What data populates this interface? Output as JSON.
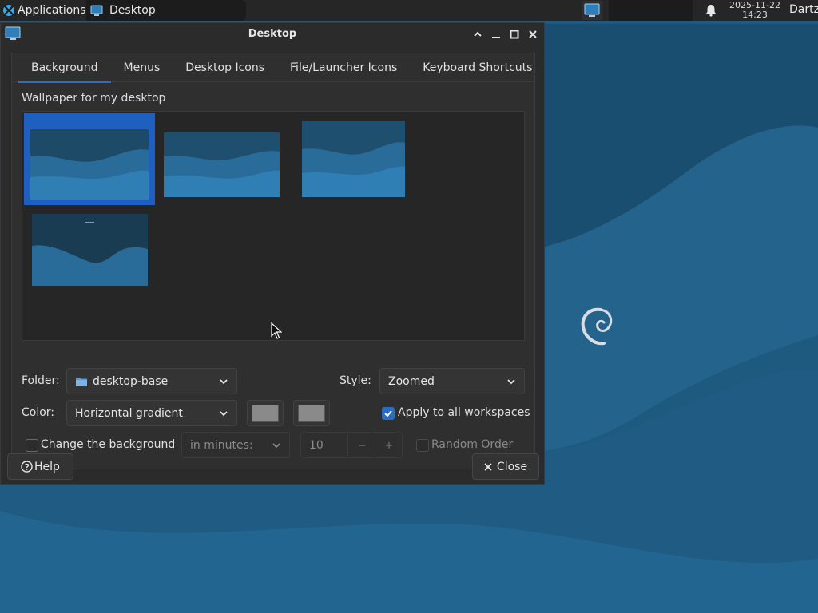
{
  "panel": {
    "apps_label": "Applications",
    "task_label": "Desktop",
    "clock_date": "2025-11-22",
    "clock_time": "14:23",
    "user": "Dartz"
  },
  "window": {
    "title": "Desktop",
    "tabs": [
      {
        "label": "Background",
        "active": true
      },
      {
        "label": "Menus"
      },
      {
        "label": "Desktop Icons"
      },
      {
        "label": "File/Launcher Icons"
      },
      {
        "label": "Keyboard Shortcuts"
      }
    ],
    "wallpaper_label": "Wallpaper for my desktop",
    "folder_label": "Folder:",
    "folder_value": "desktop-base",
    "style_label": "Style:",
    "style_value": "Zoomed",
    "color_label": "Color:",
    "color_value": "Horizontal gradient",
    "apply_all_label": "Apply to all workspaces",
    "apply_all_checked": true,
    "change_bg_label": "Change the background",
    "change_bg_checked": false,
    "interval_unit": "in minutes:",
    "interval_value": "10",
    "random_order_label": "Random Order",
    "random_order_checked": false,
    "help_label": "Help",
    "close_label": "Close"
  },
  "colors": {
    "accent": "#2a6ec2",
    "desktop_blue": "#1e5a80",
    "swatch": "#8a8a8a"
  }
}
